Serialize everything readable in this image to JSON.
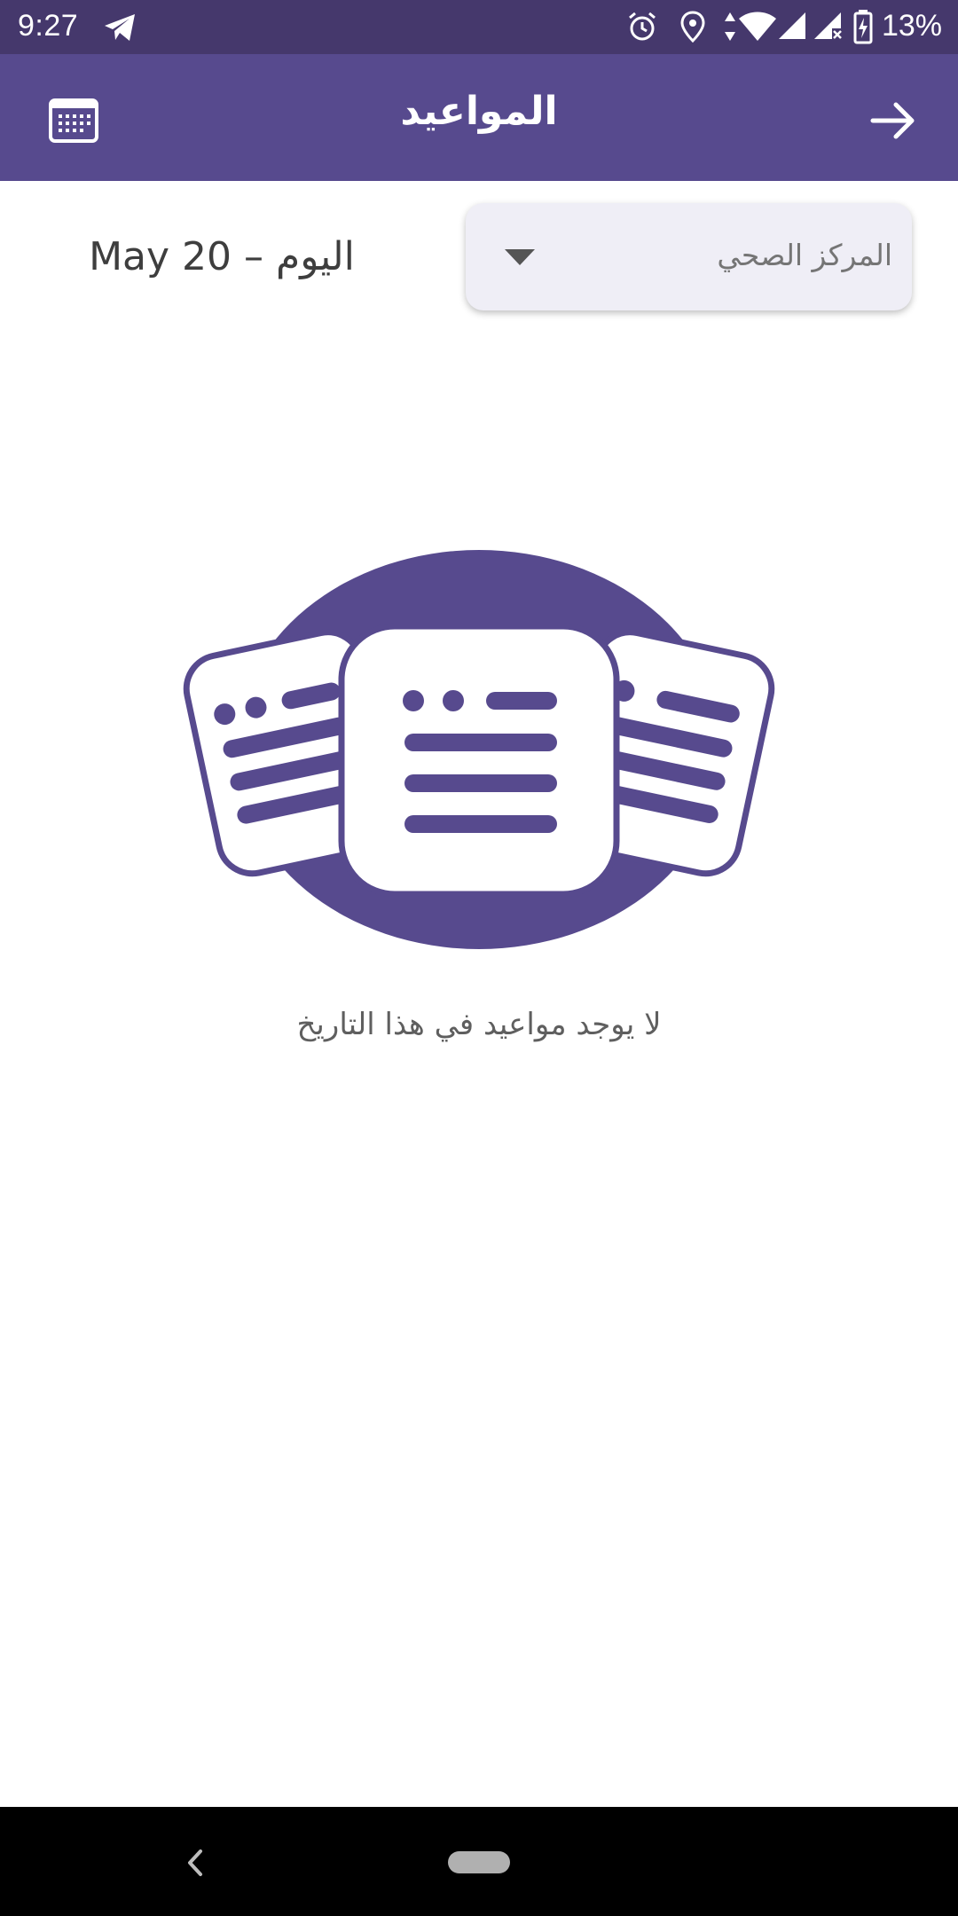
{
  "status_bar": {
    "time": "9:27",
    "battery": "13%",
    "icons": [
      "telegram-icon",
      "alarm-icon",
      "location-icon",
      "data-arrows-icon",
      "wifi-icon",
      "signal-icon",
      "signal-x-icon",
      "battery-charging-icon"
    ]
  },
  "header": {
    "title": "المواعيد",
    "left_icon": "calendar-icon",
    "right_icon": "arrow-right-icon",
    "background": "#574a8e"
  },
  "filter": {
    "date_label": "May 20 – اليوم",
    "center_dropdown": {
      "selected": "المركز الصحي"
    }
  },
  "empty_state": {
    "message": "لا يوجد مواعيد في هذا التاريخ",
    "illustration": "documents-illustration"
  },
  "nav_bar": {
    "icons": [
      "back-icon",
      "home-pill"
    ]
  },
  "colors": {
    "accent": "#574a8e",
    "status_bar": "#45386c"
  }
}
